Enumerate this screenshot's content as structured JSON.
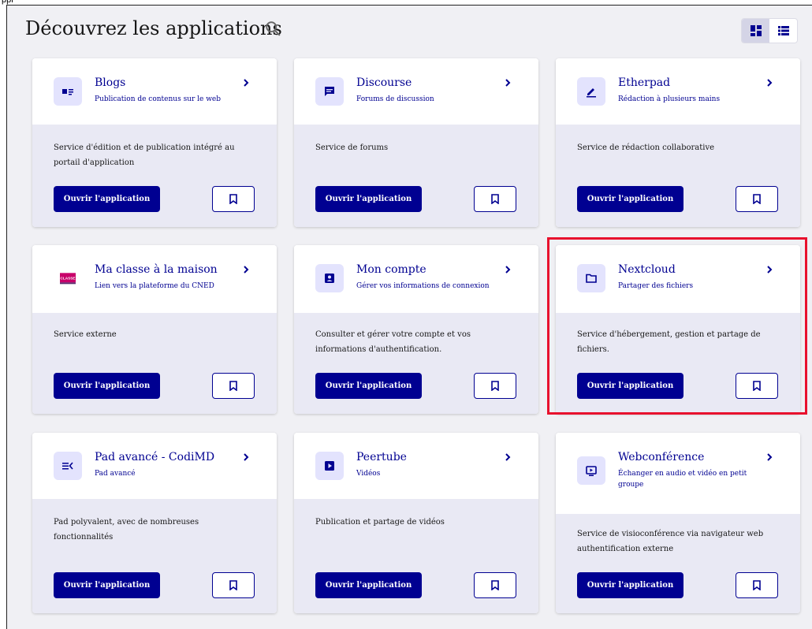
{
  "crop_text": "ppl",
  "header": {
    "title": "Découvrez les applications"
  },
  "colors": {
    "primary": "#000091",
    "icon_bg": "#e3e3fd",
    "card_bottom": "#e9e9f4",
    "page_bg": "#f0f0f4",
    "highlight": "#e8112d"
  },
  "view_toggle": {
    "grid_icon": "grid-view-icon",
    "list_icon": "list-view-icon",
    "active": "grid"
  },
  "apps": [
    {
      "name": "Blogs",
      "subtitle": "Publication de contenus sur le web",
      "description": "Service d'édition et de publication intégré au portail d'application",
      "icon": "blog-icon",
      "open_label": "Ouvrir l'application"
    },
    {
      "name": "Discourse",
      "subtitle": "Forums de discussion",
      "description": "Service de forums",
      "icon": "chat-icon",
      "open_label": "Ouvrir l'application"
    },
    {
      "name": "Etherpad",
      "subtitle": "Rédaction à plusieurs mains",
      "description": "Service de rédaction collaborative",
      "icon": "pen-icon",
      "open_label": "Ouvrir l'application"
    },
    {
      "name": "Ma classe à la maison",
      "subtitle": "Lien vers la plateforme du CNED",
      "description": "Service externe",
      "icon": "classe-logo-icon",
      "icon_text": "CLASSE",
      "open_label": "Ouvrir l'application"
    },
    {
      "name": "Mon compte",
      "subtitle": "Gérer vos informations de connexion",
      "description": "Consulter et gérer votre compte et vos informations d'authentification.",
      "icon": "account-icon",
      "open_label": "Ouvrir l'application"
    },
    {
      "name": "Nextcloud",
      "subtitle": "Partager des fichiers",
      "description": "Service d'hébergement, gestion et partage de fichiers.",
      "icon": "folder-icon",
      "open_label": "Ouvrir l'application"
    },
    {
      "name": "Pad avancé - CodiMD",
      "subtitle": "Pad avancé",
      "description": "Pad polyvalent, avec de nombreuses fonctionnalités",
      "icon": "edit-list-icon",
      "open_label": "Ouvrir l'application"
    },
    {
      "name": "Peertube",
      "subtitle": "Vidéos",
      "description": "Publication et partage de vidéos",
      "icon": "video-icon",
      "open_label": "Ouvrir l'application"
    },
    {
      "name": "Webconférence",
      "subtitle": "Échanger en audio et vidéo en petit groupe",
      "description": "Service de visioconférence via navigateur web authentification externe",
      "icon": "screen-play-icon",
      "open_label": "Ouvrir l'application"
    }
  ]
}
